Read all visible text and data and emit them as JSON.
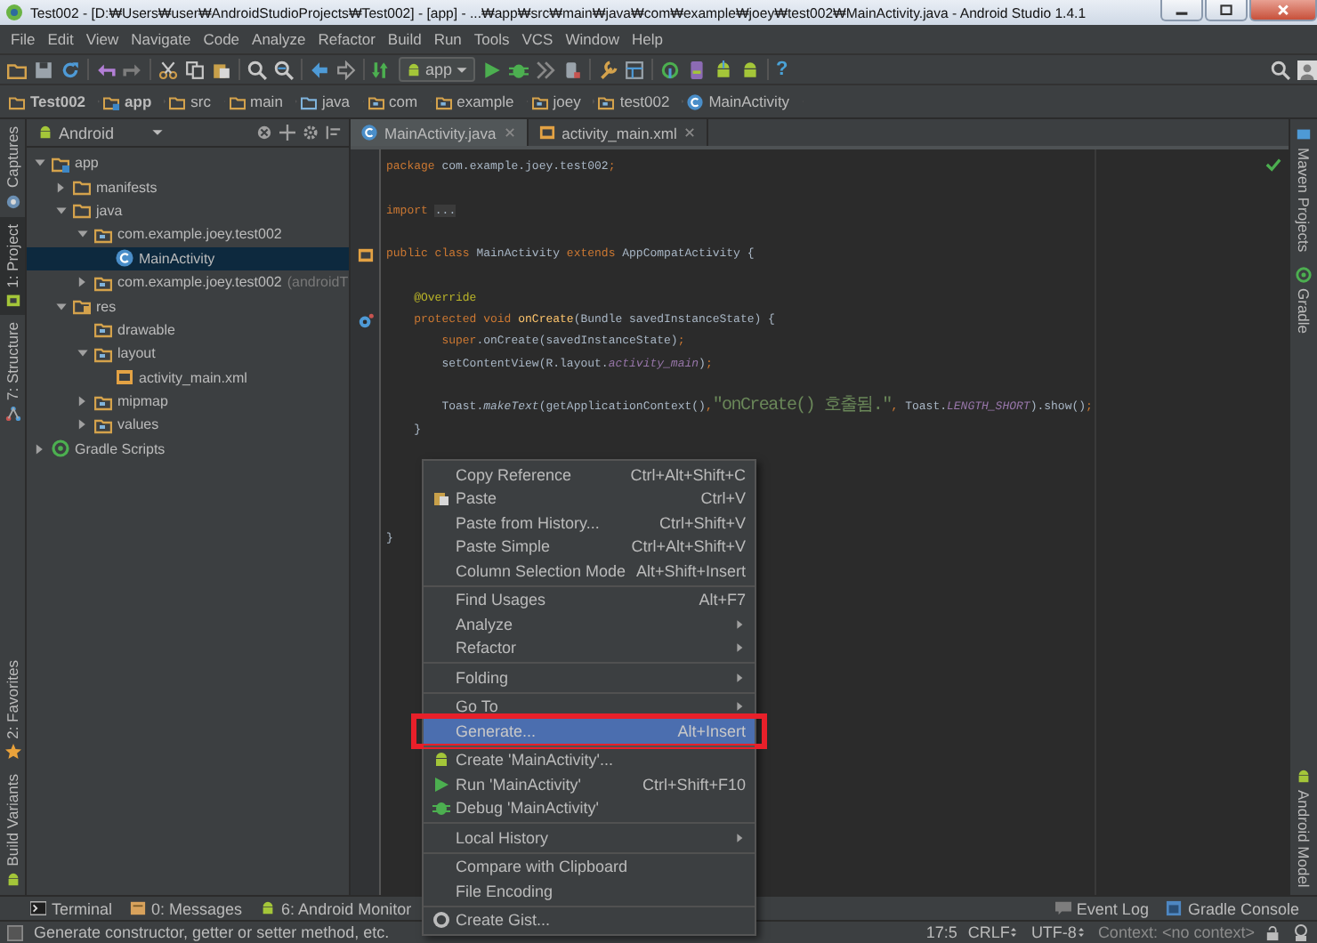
{
  "window": {
    "title": "Test002 - [D:₩Users₩user₩AndroidStudioProjects₩Test002] - [app] - ...₩app₩src₩main₩java₩com₩example₩joey₩test002₩MainActivity.java - Android Studio 1.4.1"
  },
  "menu_bar": [
    "File",
    "Edit",
    "View",
    "Navigate",
    "Code",
    "Analyze",
    "Refactor",
    "Build",
    "Run",
    "Tools",
    "VCS",
    "Window",
    "Help"
  ],
  "toolbar": {
    "run_configuration": "app",
    "help": "?"
  },
  "breadcrumbs": [
    {
      "label": "Test002",
      "kind": "project"
    },
    {
      "label": "app",
      "kind": "module"
    },
    {
      "label": "src",
      "kind": "folder"
    },
    {
      "label": "main",
      "kind": "folder"
    },
    {
      "label": "java",
      "kind": "source"
    },
    {
      "label": "com",
      "kind": "package"
    },
    {
      "label": "example",
      "kind": "package"
    },
    {
      "label": "joey",
      "kind": "package"
    },
    {
      "label": "test002",
      "kind": "package"
    },
    {
      "label": "MainActivity",
      "kind": "class"
    }
  ],
  "left_tool_strip": {
    "top": [
      {
        "label": "Captures",
        "selected": false
      },
      {
        "label": "1: Project",
        "selected": true
      },
      {
        "label": "7: Structure",
        "selected": false
      }
    ],
    "bottom": [
      {
        "label": "2: Favorites",
        "selected": false
      },
      {
        "label": "Build Variants",
        "selected": false
      }
    ]
  },
  "project_panel": {
    "view": "Android",
    "tree": [
      {
        "label": "app",
        "kind": "module",
        "expanded": true,
        "selected": false,
        "children": [
          {
            "label": "manifests",
            "kind": "folder",
            "expanded": false,
            "selected": false
          },
          {
            "label": "java",
            "kind": "folder",
            "expanded": true,
            "selected": false,
            "children": [
              {
                "label": "com.example.joey.test002",
                "kind": "package",
                "expanded": true,
                "selected": false,
                "children": [
                  {
                    "label": "MainActivity",
                    "kind": "class",
                    "selected": true
                  }
                ]
              },
              {
                "label": "com.example.joey.test002",
                "suffix": "(androidT",
                "kind": "package",
                "expanded": false,
                "selected": false
              }
            ]
          },
          {
            "label": "res",
            "kind": "resources",
            "expanded": true,
            "selected": false,
            "children": [
              {
                "label": "drawable",
                "kind": "package",
                "selected": false
              },
              {
                "label": "layout",
                "kind": "package",
                "expanded": true,
                "selected": false,
                "children": [
                  {
                    "label": "activity_main.xml",
                    "kind": "xml",
                    "selected": false
                  }
                ]
              },
              {
                "label": "mipmap",
                "kind": "package",
                "expanded": false,
                "selected": false
              },
              {
                "label": "values",
                "kind": "package",
                "expanded": false,
                "selected": false
              }
            ]
          }
        ]
      },
      {
        "label": "Gradle Scripts",
        "kind": "gradle",
        "expanded": false,
        "selected": false
      }
    ]
  },
  "editor": {
    "tabs": [
      {
        "label": "MainActivity.java",
        "kind": "class",
        "selected": true
      },
      {
        "label": "activity_main.xml",
        "kind": "xml",
        "selected": false
      }
    ],
    "lines": [
      {
        "kind": "code",
        "tokens": [
          {
            "kind": "keyword",
            "text": "package"
          },
          {
            "kind": "plain",
            "text": " com.example.joey.test002"
          },
          {
            "kind": "keyword",
            "text": ";"
          }
        ]
      },
      {
        "kind": "blank"
      },
      {
        "kind": "code",
        "tokens": [
          {
            "kind": "keyword",
            "text": "import"
          },
          {
            "kind": "folded",
            "text": "..."
          }
        ]
      },
      {
        "kind": "blank"
      },
      {
        "kind": "code",
        "gutter": {
          "kind": "layout"
        },
        "tokens": [
          {
            "kind": "keyword",
            "text": "public class"
          },
          {
            "kind": "plain",
            "text": " MainActivity "
          },
          {
            "kind": "keyword",
            "text": "extends"
          },
          {
            "kind": "plain",
            "text": " AppCompatActivity {"
          }
        ]
      },
      {
        "kind": "blank"
      },
      {
        "kind": "code",
        "tokens": [
          {
            "kind": "annotation",
            "text": "    @Override"
          }
        ]
      },
      {
        "kind": "code",
        "gutter": {
          "kind": "override"
        },
        "tokens": [
          {
            "kind": "keyword",
            "text": "    protected void"
          },
          {
            "kind": "method",
            "text": " onCreate"
          },
          {
            "kind": "plain",
            "text": "(Bundle savedInstanceState) {"
          }
        ]
      },
      {
        "kind": "code",
        "tokens": [
          {
            "kind": "keyword",
            "text": "        super"
          },
          {
            "kind": "plain",
            "text": ".onCreate(savedInstanceState)"
          },
          {
            "kind": "keyword",
            "text": ";"
          }
        ]
      },
      {
        "kind": "code",
        "tokens": [
          {
            "kind": "plain",
            "text": "        setContentView(R.layout."
          },
          {
            "kind": "field",
            "text": "activity_main"
          },
          {
            "kind": "plain",
            "text": ")"
          },
          {
            "kind": "keyword",
            "text": ";"
          }
        ]
      },
      {
        "kind": "blank"
      },
      {
        "kind": "code",
        "tokens": [
          {
            "kind": "plain",
            "text": "        Toast."
          },
          {
            "kind": "static",
            "text": "makeText"
          },
          {
            "kind": "plain",
            "text": "(getApplicationContext()"
          },
          {
            "kind": "keyword",
            "text": ","
          },
          {
            "kind": "string",
            "text": "\"onCreate() 호출됨.\""
          },
          {
            "kind": "keyword",
            "text": ","
          },
          {
            "kind": "plain",
            "text": " Toast."
          },
          {
            "kind": "field",
            "text": "LENGTH_SHORT"
          },
          {
            "kind": "plain",
            "text": ").show()"
          },
          {
            "kind": "keyword",
            "text": ";"
          }
        ]
      },
      {
        "kind": "code",
        "tokens": [
          {
            "kind": "plain",
            "text": "    }"
          }
        ]
      },
      {
        "kind": "blank"
      },
      {
        "kind": "blank"
      },
      {
        "kind": "blank"
      },
      {
        "kind": "blank"
      },
      {
        "kind": "code",
        "tokens": [
          {
            "kind": "plain",
            "text": "}"
          }
        ]
      }
    ]
  },
  "right_tool_strip": {
    "top": [
      {
        "label": "Maven Projects",
        "kind": "maven"
      },
      {
        "label": "Gradle",
        "kind": "gradle"
      }
    ],
    "bottom": [
      {
        "label": "Android Model",
        "kind": "android"
      }
    ]
  },
  "context_menu": {
    "groups": [
      [
        {
          "label": "Copy Reference",
          "shortcut": "Ctrl+Alt+Shift+C",
          "kind": "plain",
          "selected": false
        },
        {
          "label": "Paste",
          "shortcut": "Ctrl+V",
          "kind": "paste",
          "selected": false
        },
        {
          "label": "Paste from History...",
          "shortcut": "Ctrl+Shift+V",
          "kind": "plain",
          "selected": false
        },
        {
          "label": "Paste Simple",
          "shortcut": "Ctrl+Alt+Shift+V",
          "kind": "plain",
          "selected": false
        },
        {
          "label": "Column Selection Mode",
          "shortcut": "Alt+Shift+Insert",
          "kind": "plain",
          "selected": false
        }
      ],
      [
        {
          "label": "Find Usages",
          "shortcut": "Alt+F7",
          "kind": "plain",
          "selected": false
        },
        {
          "label": "Analyze",
          "submenu": true,
          "kind": "plain",
          "selected": false
        },
        {
          "label": "Refactor",
          "submenu": true,
          "kind": "plain",
          "selected": false
        }
      ],
      [
        {
          "label": "Folding",
          "submenu": true,
          "kind": "plain",
          "selected": false
        }
      ],
      [
        {
          "label": "Go To",
          "submenu": true,
          "kind": "plain",
          "selected": false
        },
        {
          "label": "Generate...",
          "shortcut": "Alt+Insert",
          "kind": "plain",
          "selected": true,
          "highlighted": true
        }
      ],
      [
        {
          "label": "Create 'MainActivity'...",
          "kind": "android",
          "selected": false
        },
        {
          "label": "Run 'MainActivity'",
          "shortcut": "Ctrl+Shift+F10",
          "kind": "run",
          "selected": false
        },
        {
          "label": "Debug 'MainActivity'",
          "kind": "debug",
          "selected": false
        }
      ],
      [
        {
          "label": "Local History",
          "submenu": true,
          "kind": "plain",
          "selected": false
        }
      ],
      [
        {
          "label": "Compare with Clipboard",
          "kind": "plain",
          "selected": false
        },
        {
          "label": "File Encoding",
          "kind": "plain",
          "selected": false
        }
      ],
      [
        {
          "label": "Create Gist...",
          "kind": "gist",
          "selected": false
        }
      ]
    ]
  },
  "bottom_tool_tabs": {
    "left": [
      {
        "label": "Terminal",
        "kind": "terminal"
      },
      {
        "label": "0: Messages",
        "kind": "messages"
      },
      {
        "label": "6: Android Monitor",
        "kind": "android"
      }
    ],
    "right": [
      {
        "label": "Event Log",
        "kind": "log"
      },
      {
        "label": "Gradle Console",
        "kind": "console"
      }
    ]
  },
  "status_bar": {
    "message": "Generate constructor, getter or setter method, etc.",
    "position": "17:5",
    "line_separator": "CRLF",
    "encoding": "UTF-8",
    "context": "Context: <no context>"
  }
}
